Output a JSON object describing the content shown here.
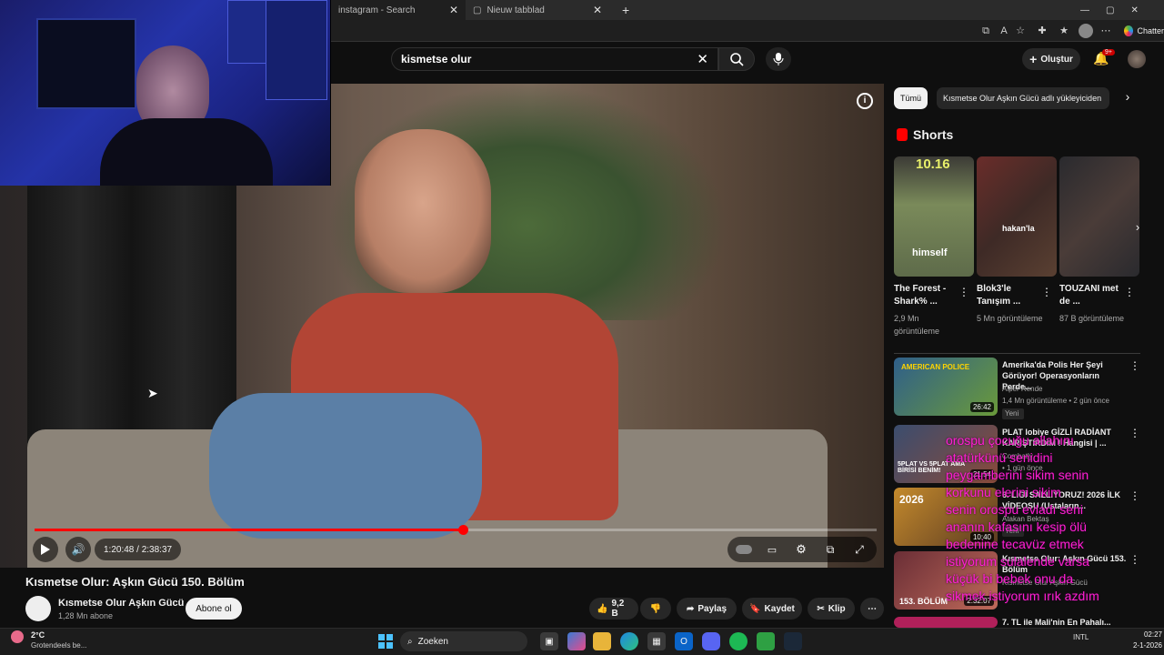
{
  "browser": {
    "tabs": [
      {
        "title": "instagram - Search"
      },
      {
        "title": "Nieuw tabblad"
      }
    ],
    "profile_label": "Chatter"
  },
  "youtube": {
    "search_value": "kismetse olur",
    "create_label": "Oluştur",
    "notification_count": "9+"
  },
  "player": {
    "time_display": "1:20:48 / 2:38:37",
    "progress": 0.509
  },
  "video": {
    "title": "Kısmetse Olur: Aşkın Gücü 150. Bölüm",
    "channel": "Kısmetse Olur Aşkın Gücü",
    "subscribers": "1,28 Mn abone",
    "subscribe_label": "Abone ol",
    "likes": "9,2 B",
    "share_label": "Paylaş",
    "save_label": "Kaydet",
    "clip_label": "Klip"
  },
  "chips": [
    "Tümü",
    "Kısmetse Olur Aşkın Gücü adlı yükleyiciden"
  ],
  "shorts": {
    "heading": "Shorts",
    "items": [
      {
        "title": "The Forest - Shark% ...",
        "views": "2,9 Mn görüntüleme",
        "thumb_text": "himself",
        "thumb_top": "10.16",
        "color": "#5e6b4a"
      },
      {
        "title": "Blok3'le Tanışım ...",
        "views": "5 Mn görüntüleme",
        "thumb_text": "hakan'la",
        "thumb_top": "",
        "color": "#4a2a22"
      },
      {
        "title": "TOUZANI met de ...",
        "views": "87 B görüntüleme",
        "thumb_text": "",
        "thumb_top": "",
        "color": "#3a3a3e"
      }
    ]
  },
  "recommended": [
    {
      "title": "Amerika'da Polis Her Şeyi Görüyor! Operasyonların Perde...",
      "channel": "Alper Rende",
      "meta": "1,4 Mn görüntüleme • 2 gün önce",
      "badge": "Yeni",
      "duration": "26:42",
      "thumb_text": "AMERICAN POLICE",
      "color": "#2f5f8a"
    },
    {
      "title": "PLAT lobiye GİZLİ RADİANT KARIŞTIRDIM ! Hangisi | ...",
      "channel": "Combatly",
      "meta": "• 1 gün önce",
      "badge": "",
      "duration": "21:54",
      "thumb_text": "5PLAT VS 5PLAT AMA BİRİSİ BENİM!",
      "color": "#3b4d6e"
    },
    {
      "title": "6. LİGİ SALLIYORUZ! 2026 İLK VİDEOSU (Ustaların...",
      "channel": "Atakan Bektaş",
      "meta": "",
      "badge": "Yeni",
      "duration": "10:40",
      "thumb_text": "2026",
      "color": "#c48a2c"
    },
    {
      "title": "Kısmetse Olur: Aşkın Gücü 153. Bölüm",
      "channel": "Kısmetse Olur Aşkın Gücü",
      "meta": "",
      "badge": "",
      "duration": "2:32:07",
      "thumb_text": "153. BÖLÜM",
      "color": "#6a2e36"
    },
    {
      "title": "7. TL ile Mali'nin En Pahalı...",
      "channel": "",
      "meta": "",
      "badge": "",
      "duration": "",
      "thumb_text": "",
      "color": "#b0205a"
    }
  ],
  "overlay_chat": [
    "orospu çocuğu allahını",
    "atatürkünü senidini",
    "peygamberini sikim senin",
    "korkunu elerini sikim",
    "senin orospu evladı seni",
    "ananın kafasını kesip ölü",
    "bedenine tecavüz etmek",
    "istiyorum sulalende varsa",
    "küçük bi bebek onu da",
    "sikmek istiyorum ırık azdım"
  ],
  "taskbar": {
    "temperature": "2°C",
    "weather": "Grotendeels be...",
    "search_placeholder": "Zoeken",
    "lang": "INTL",
    "time": "02:27",
    "date": "2-1-2026"
  },
  "colors": {
    "youtube_red": "#ff0000",
    "overlay_pink": "#ff1fd2"
  }
}
